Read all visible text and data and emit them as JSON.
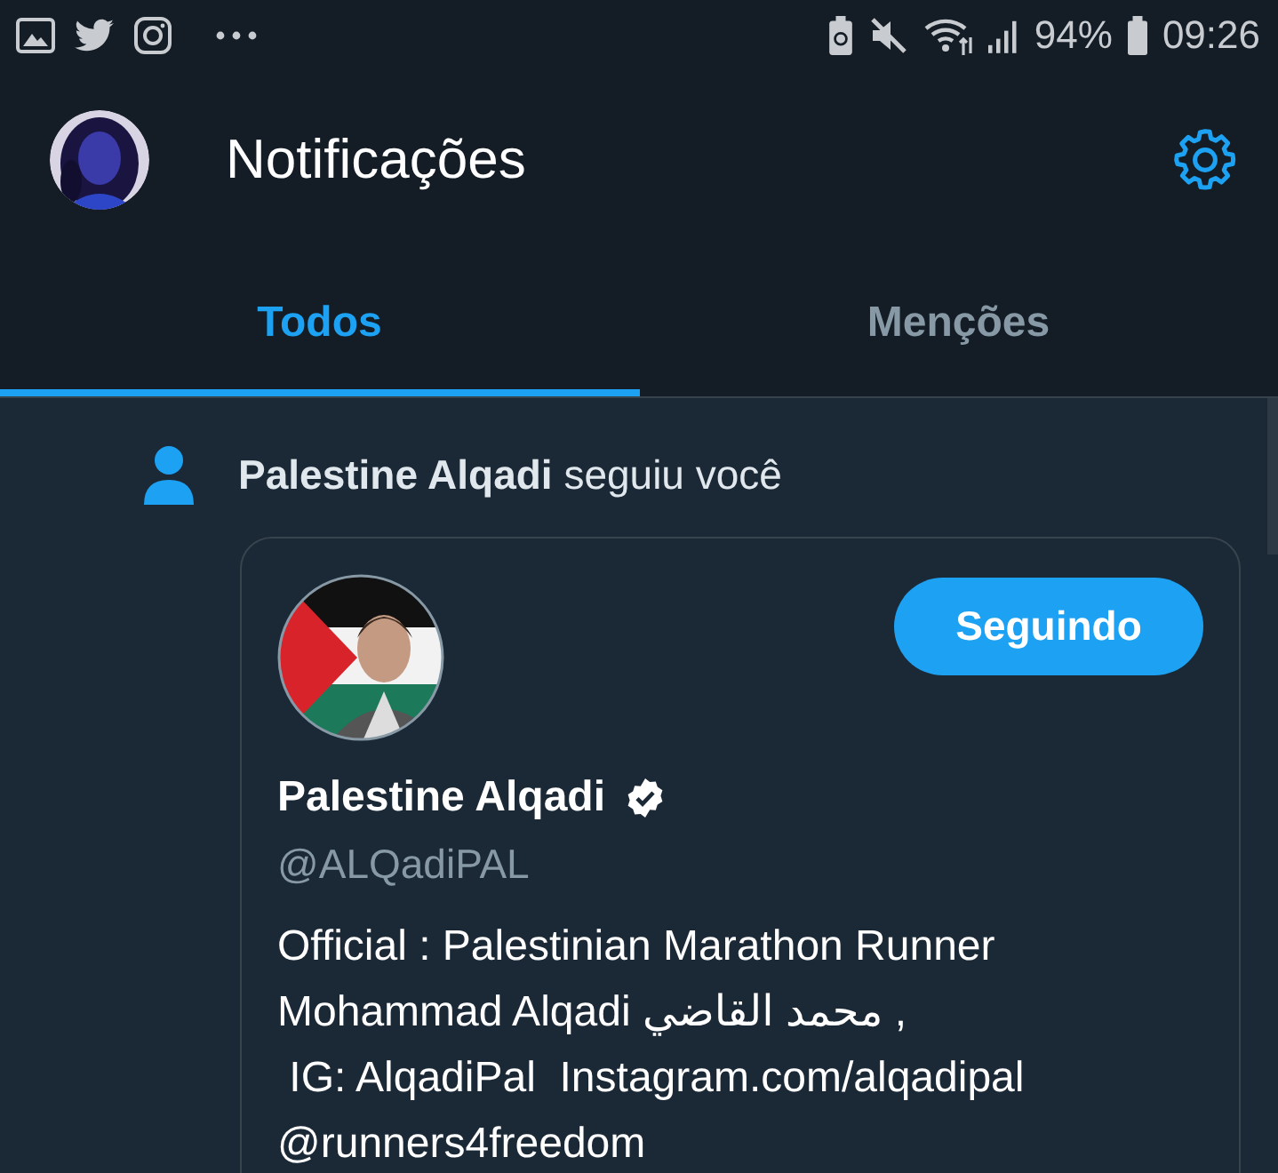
{
  "status_bar": {
    "battery_percent": "94%",
    "time": "09:26"
  },
  "header": {
    "title": "Notificações"
  },
  "tabs": [
    {
      "label": "Todos",
      "selected": true
    },
    {
      "label": "Menções",
      "selected": false
    }
  ],
  "notifications": [
    {
      "kind": "follow",
      "text": "**Palestine Alqadi** seguiu você",
      "card": {
        "button": "Seguindo",
        "name": "Palestine Alqadi",
        "verified": true,
        "handle": "@ALQadiPAL",
        "bio_lines": [
          "Official : Palestinian Marathon Runner",
          "Mohammad Alqadi محمد القاضي ,",
          " IG: AlqadiPal  Instagram.com/alqadipal",
          "@runners4freedom"
        ]
      }
    }
  ]
}
